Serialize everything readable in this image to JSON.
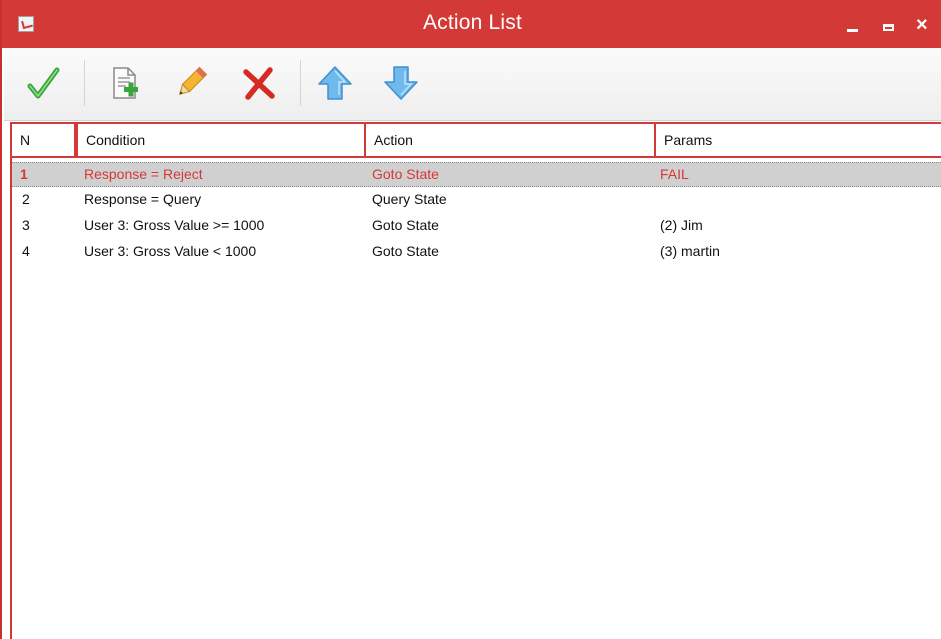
{
  "window": {
    "title": "Action List",
    "app_icon": "app-icon",
    "controls": {
      "minimize": "minimize-icon",
      "maximize": "maximize-icon",
      "close": "×"
    }
  },
  "toolbar": {
    "buttons": [
      {
        "name": "confirm-button",
        "icon": "checkmark-icon"
      },
      {
        "name": "add-button",
        "icon": "add-document-icon"
      },
      {
        "name": "edit-button",
        "icon": "pencil-icon"
      },
      {
        "name": "delete-button",
        "icon": "red-x-icon"
      },
      {
        "name": "move-up-button",
        "icon": "up-arrow-icon"
      },
      {
        "name": "move-down-button",
        "icon": "down-arrow-icon"
      }
    ]
  },
  "table": {
    "columns": [
      "N",
      "Condition",
      "Action",
      "Params"
    ],
    "rows": [
      {
        "n": "1",
        "condition": "Response = Reject",
        "action": "Goto State",
        "params": "FAIL",
        "selected": true
      },
      {
        "n": "2",
        "condition": "Response = Query",
        "action": "Query State",
        "params": ""
      },
      {
        "n": "3",
        "condition": "User 3: Gross Value >= 1000",
        "action": "Goto State",
        "params": "(2) Jim"
      },
      {
        "n": "4",
        "condition": "User 3: Gross Value < 1000",
        "action": "Goto State",
        "params": "(3) martin"
      }
    ]
  },
  "colors": {
    "accent": "#d33a37",
    "selection": "#d0d0d0"
  }
}
